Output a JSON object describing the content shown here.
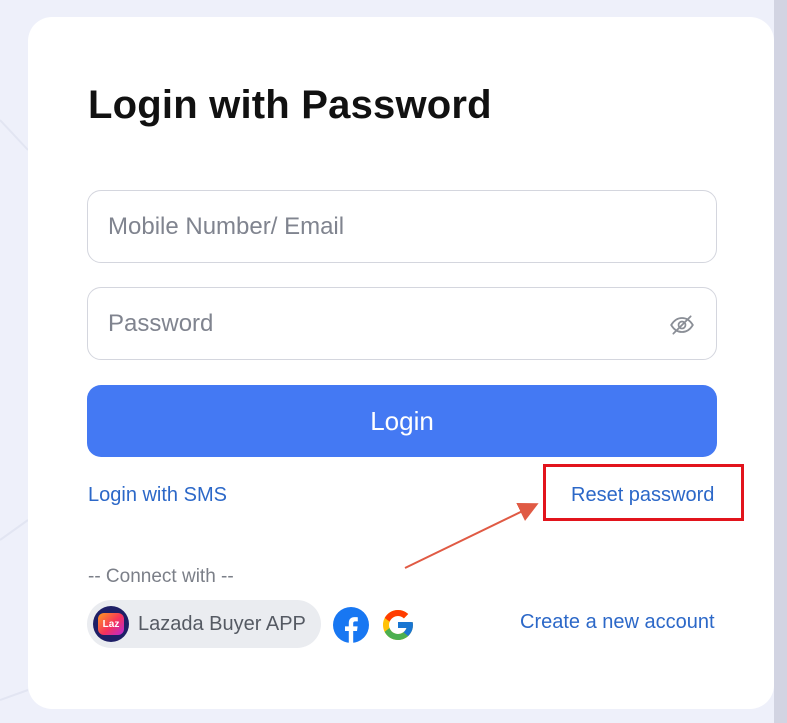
{
  "login": {
    "title": "Login with Password",
    "email_placeholder": "Mobile Number/ Email",
    "password_placeholder": "Password",
    "login_button": "Login",
    "sms_link": "Login with SMS",
    "reset_link": "Reset password",
    "connect_label": "-- Connect with --",
    "lazada_button": "Lazada Buyer APP",
    "lazada_logo_text": "Laz",
    "create_account_link": "Create a new account"
  },
  "colors": {
    "primary": "#4479f3",
    "link": "#2c68c8",
    "highlight": "#e2141c",
    "arrow": "#e05a44"
  }
}
